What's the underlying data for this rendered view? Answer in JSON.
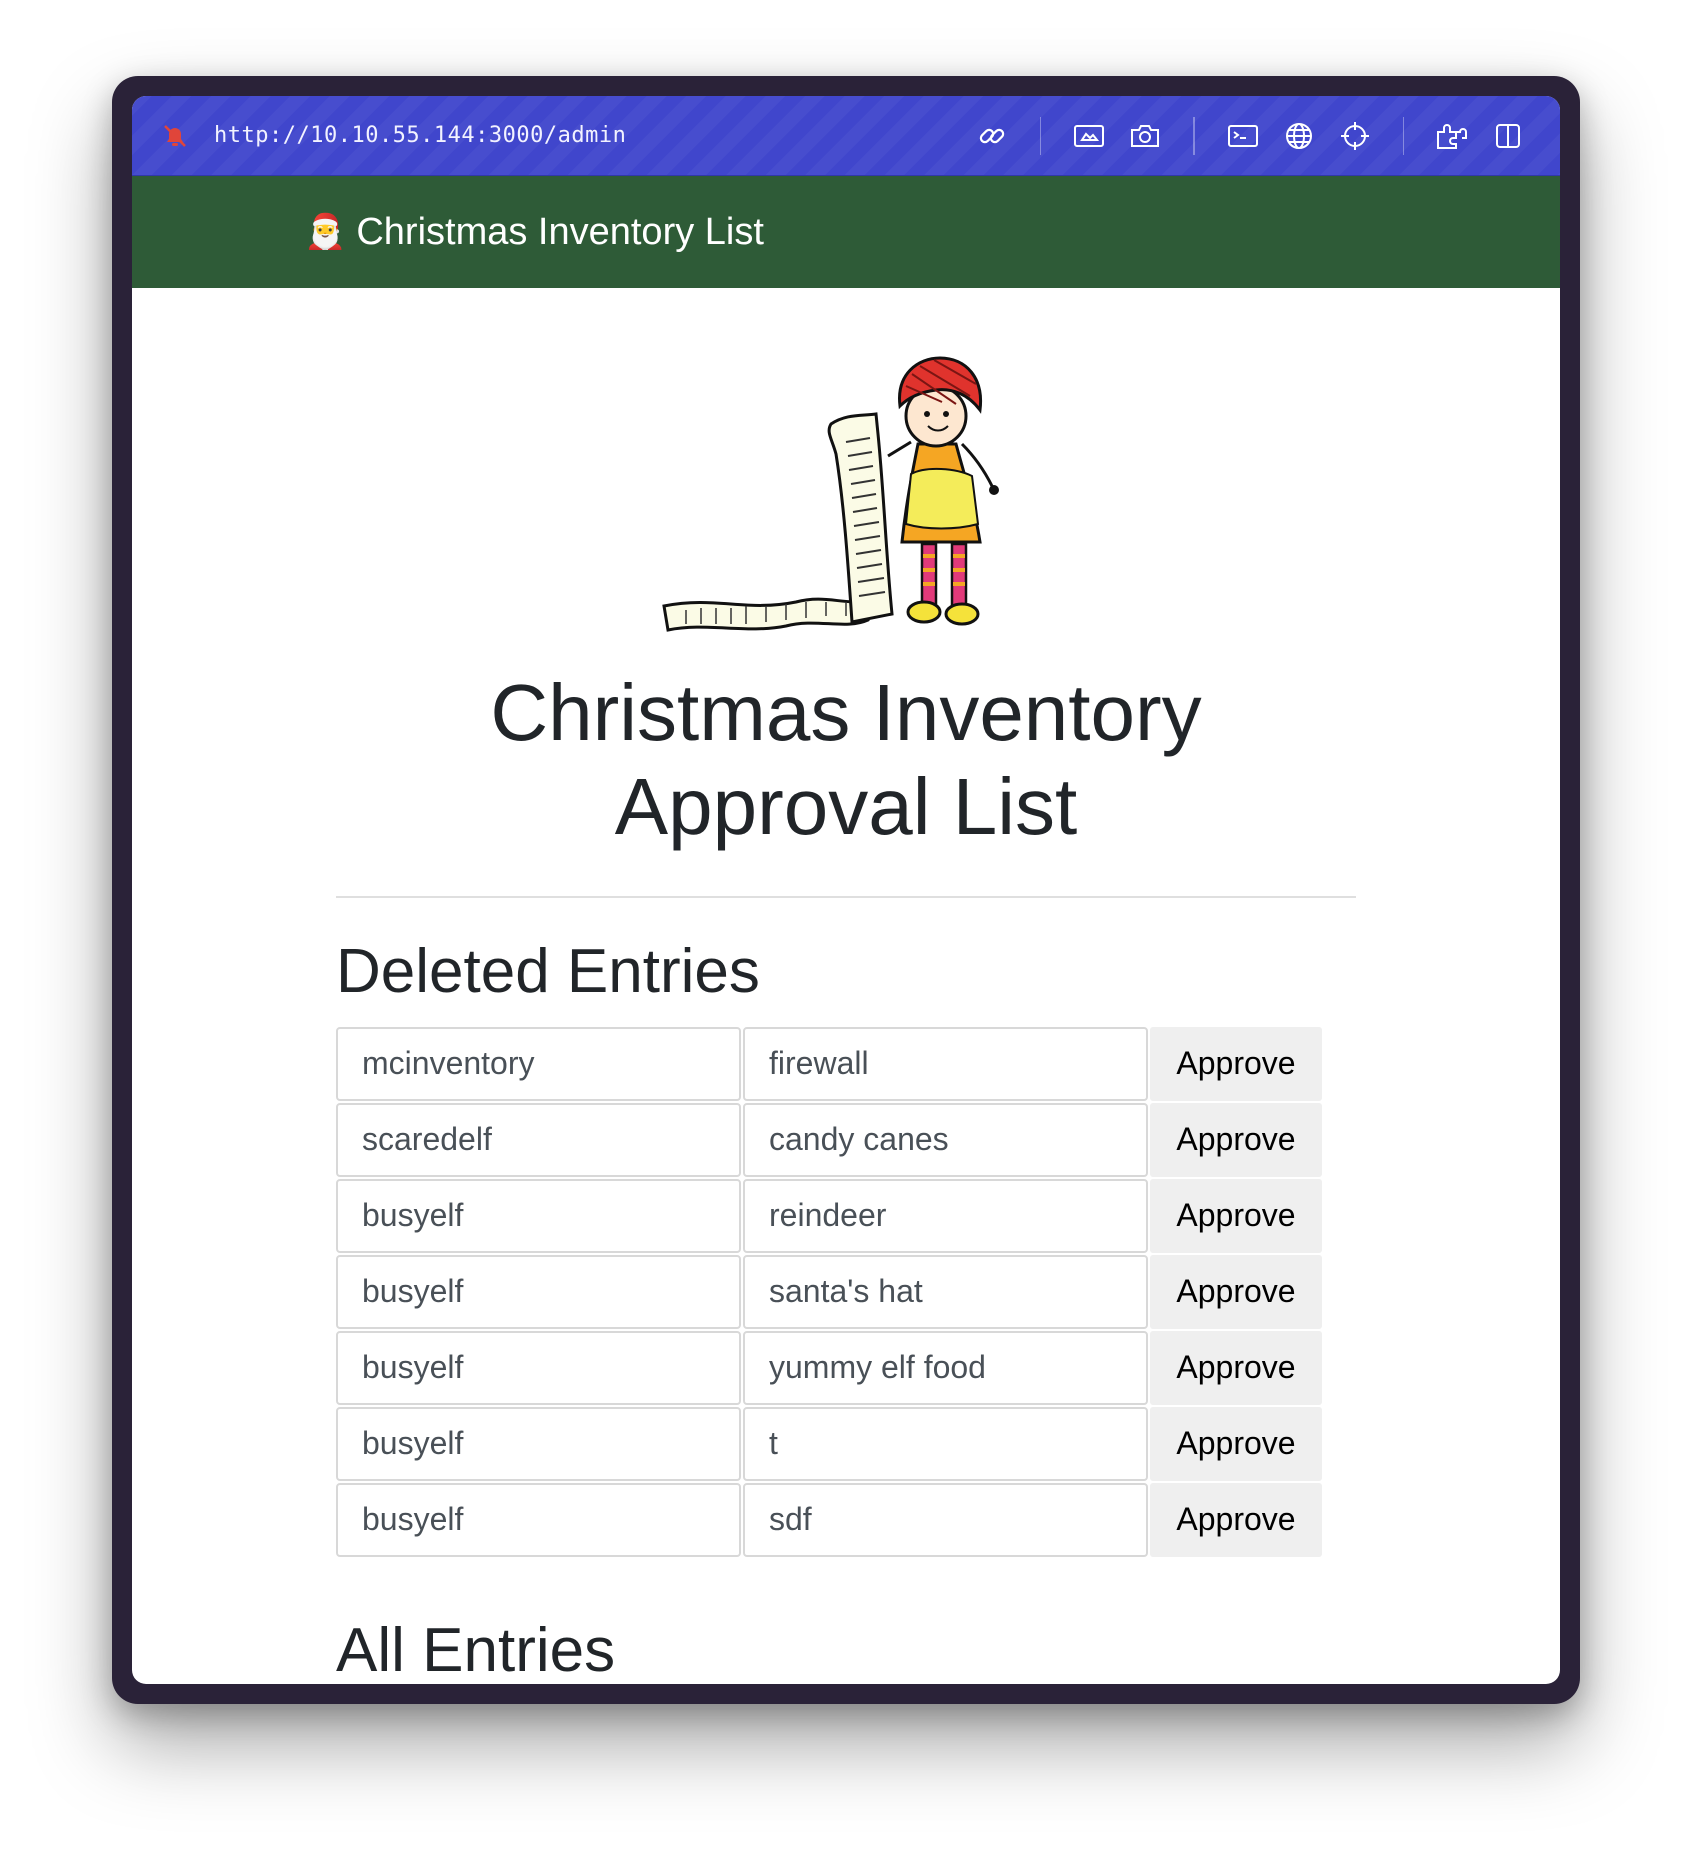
{
  "browser": {
    "url": "http://10.10.55.144:3000/admin"
  },
  "navbar": {
    "emoji": "🎅",
    "brand": "Christmas Inventory List"
  },
  "page": {
    "title_line1": "Christmas Inventory",
    "title_line2": "Approval List",
    "deleted_heading": "Deleted Entries",
    "all_heading": "All Entries"
  },
  "deleted_entries": [
    {
      "user": "mcinventory",
      "item": "firewall",
      "action": "Approve"
    },
    {
      "user": "scaredelf",
      "item": "candy canes",
      "action": "Approve"
    },
    {
      "user": "busyelf",
      "item": "reindeer",
      "action": "Approve"
    },
    {
      "user": "busyelf",
      "item": "santa's hat",
      "action": "Approve"
    },
    {
      "user": "busyelf",
      "item": "yummy elf food",
      "action": "Approve"
    },
    {
      "user": "busyelf",
      "item": "t",
      "action": "Approve"
    },
    {
      "user": "busyelf",
      "item": "sdf",
      "action": "Approve"
    }
  ],
  "icons": {
    "url_status": "no-bell-icon",
    "toolbar": [
      "link-icon",
      "image-icon",
      "camera-icon",
      "terminal-icon",
      "globe-icon",
      "crosshair-icon",
      "extensions-icon",
      "sidebar-icon"
    ]
  },
  "colors": {
    "urlbar": "#4046cc",
    "navbar": "#2e5b37",
    "button_bg": "#efefef"
  }
}
